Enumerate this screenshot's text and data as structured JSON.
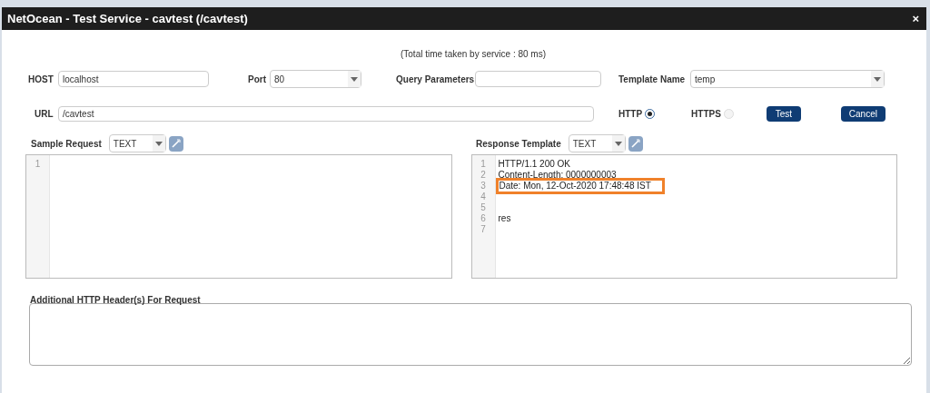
{
  "window": {
    "title": "NetOcean - Test Service - cavtest (/cavtest)",
    "close": "×"
  },
  "timing": "(Total time taken by service : 80 ms)",
  "host": {
    "label": "HOST",
    "value": "localhost"
  },
  "port": {
    "label": "Port",
    "value": "80"
  },
  "query_parameters": {
    "label": "Query Parameters"
  },
  "template_name": {
    "label": "Template Name",
    "value": "temp"
  },
  "url": {
    "label": "URL",
    "value": "/cavtest"
  },
  "protocols": [
    {
      "label": "HTTP",
      "selected": true
    },
    {
      "label": "HTTPS",
      "selected": false
    }
  ],
  "buttons": [
    "Test",
    "Cancel"
  ],
  "sample_request": {
    "label": "Sample Request",
    "format": "TEXT",
    "lines": [
      {
        "number": "1"
      }
    ]
  },
  "response_template": {
    "label": "Response Template",
    "format": "TEXT",
    "lines": [
      {
        "number": "1",
        "text": "HTTP/1.1 200 OK",
        "highlighted": false
      },
      {
        "number": "2",
        "text": "Content-Length: 0000000003",
        "highlighted": false
      },
      {
        "number": "3",
        "text": "Date: Mon, 12-Oct-2020 17:48:48 IST",
        "highlighted": true
      },
      {
        "number": "4",
        "highlighted": false
      },
      {
        "number": "5",
        "highlighted": false
      },
      {
        "number": "6",
        "text": "res",
        "highlighted": false
      },
      {
        "number": "7",
        "highlighted": false
      }
    ]
  },
  "additional_headers": {
    "label": "Additional HTTP Header(s) For Request"
  }
}
